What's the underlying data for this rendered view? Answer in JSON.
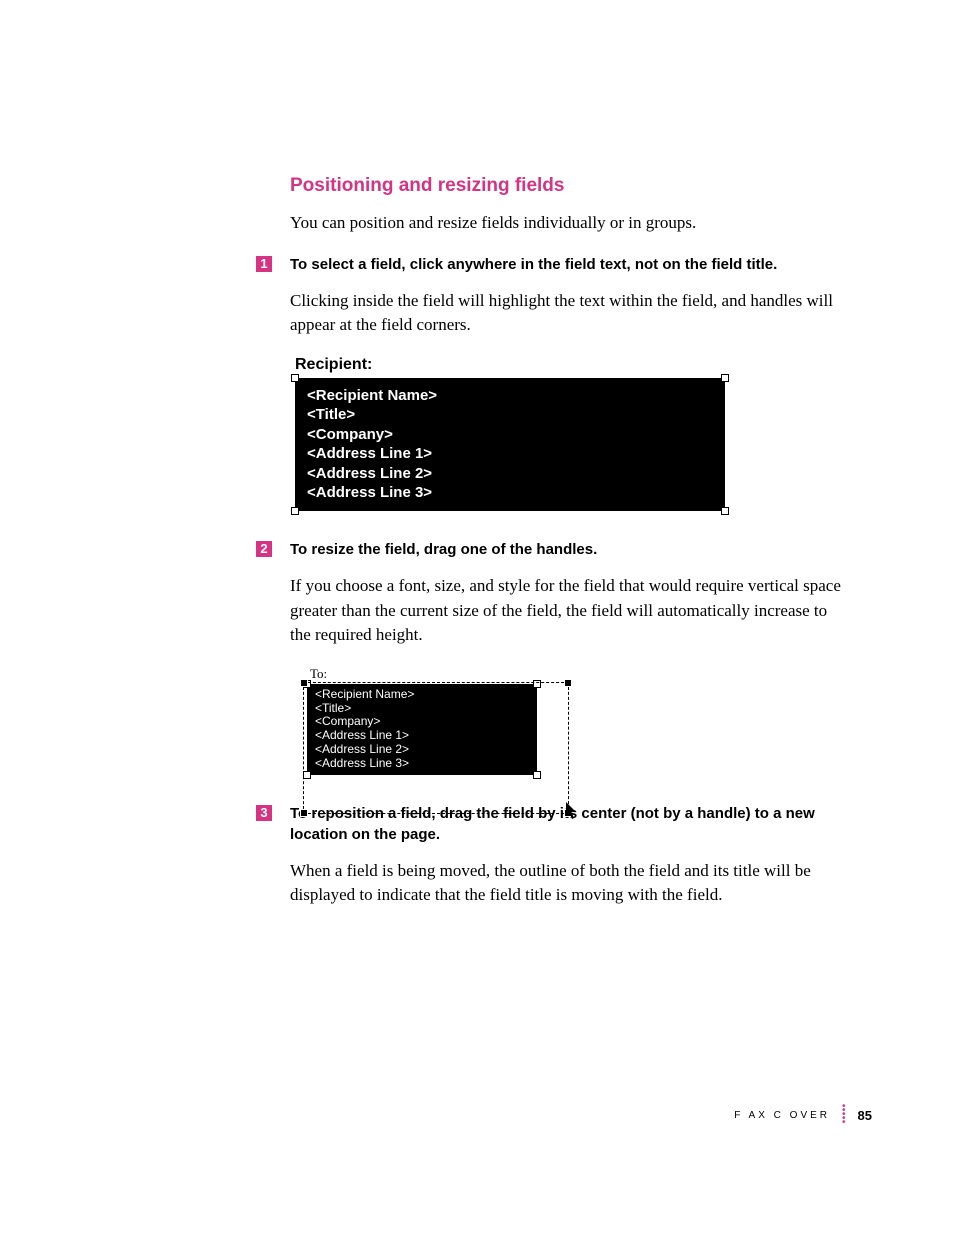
{
  "section_title": "Positioning and resizing fields",
  "intro": "You can position and resize fields individually or in groups.",
  "steps": [
    {
      "num": "1",
      "bold": "To select a field, click anywhere in the field text, not on the field title.",
      "body": "Clicking inside the field will highlight the text within the field, and handles will appear at the field corners."
    },
    {
      "num": "2",
      "bold": "To resize the field, drag one of the handles.",
      "body": "If you choose a font, size, and style for the field that would require vertical space greater than the current size of the field, the field will automatically increase to the required height."
    },
    {
      "num": "3",
      "bold": "To reposition a field, drag the field by its center (not by a handle) to a new location on the page.",
      "body": "When a field is being moved, the outline of both the field and its title will be displayed to indicate that the field title is moving with the field."
    }
  ],
  "figure1": {
    "label": "Recipient:",
    "lines": [
      "<Recipient Name>",
      "<Title>",
      "<Company>",
      "<Address Line 1>",
      "<Address Line 2>",
      "<Address Line 3>"
    ]
  },
  "figure2": {
    "label": "To:",
    "lines": [
      "<Recipient Name>",
      "<Title>",
      "<Company>",
      "<Address Line 1>",
      "<Address Line 2>",
      "<Address Line 3>"
    ]
  },
  "footer": {
    "section": "F AX  C OVER",
    "page": "85"
  }
}
